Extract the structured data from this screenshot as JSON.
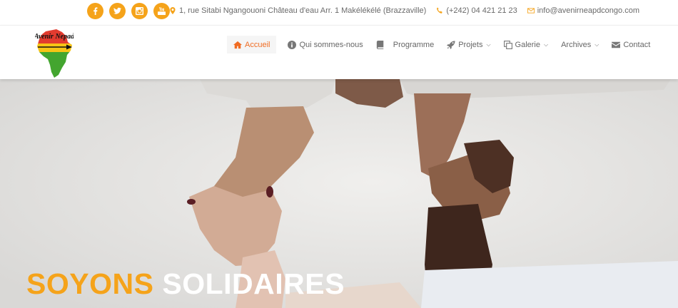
{
  "colors": {
    "accent": "#f5a31a",
    "active_nav": "#f06c23",
    "text": "#666666",
    "hero_bg": "#ebeae8"
  },
  "social": [
    {
      "name": "facebook",
      "glyph": "f"
    },
    {
      "name": "twitter",
      "glyph": "t"
    },
    {
      "name": "instagram",
      "glyph": "i"
    },
    {
      "name": "youtube",
      "glyph": "y"
    }
  ],
  "contact": {
    "address": "1, rue Sitabi Ngangouoni Château d'eau Arr. 1 Makélékélé (Brazzaville)",
    "phone": "(+242) 04 421 21 23",
    "email": "info@avenirneapdcongo.com"
  },
  "logo": {
    "text": "Avenir Nepad"
  },
  "nav": {
    "home": "Accueil",
    "about": "Qui sommes-nous",
    "program": "Programme",
    "projects": "Projets",
    "gallery": "Galerie",
    "archives": "Archives",
    "contact": "Contact"
  },
  "hero": {
    "headline_accent": "SOYONS",
    "headline_rest": "SOLIDAIRES"
  }
}
